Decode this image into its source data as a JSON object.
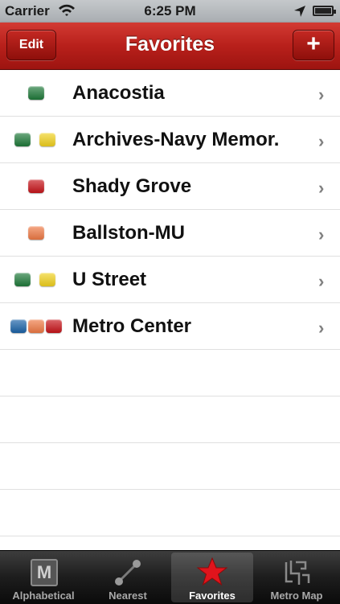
{
  "status_bar": {
    "carrier": "Carrier",
    "time": "6:25 PM",
    "wifi_icon": "wifi-icon",
    "location_icon": "location-arrow-icon",
    "battery_icon": "battery-icon"
  },
  "nav": {
    "title": "Favorites",
    "edit_label": "Edit",
    "add_label": "+"
  },
  "line_colors": {
    "green": "#1f7a3a",
    "yellow": "#f2d21e",
    "red": "#c8141a",
    "orange": "#f07a45",
    "blue": "#1b63a8"
  },
  "stations": [
    {
      "name": "Anacostia",
      "lines": [
        "green"
      ]
    },
    {
      "name": "Archives-Navy Memor.",
      "lines": [
        "green",
        "yellow"
      ]
    },
    {
      "name": "Shady Grove",
      "lines": [
        "red"
      ]
    },
    {
      "name": "Ballston-MU",
      "lines": [
        "orange"
      ]
    },
    {
      "name": "U Street",
      "lines": [
        "green",
        "yellow"
      ]
    },
    {
      "name": "Metro Center",
      "lines": [
        "blue",
        "orange",
        "red"
      ]
    }
  ],
  "tabs": [
    {
      "label": "Alphabetical",
      "icon": "m-icon",
      "selected": false
    },
    {
      "label": "Nearest",
      "icon": "nearest-icon",
      "selected": false
    },
    {
      "label": "Favorites",
      "icon": "star-icon",
      "selected": true
    },
    {
      "label": "Metro Map",
      "icon": "metro-map-icon",
      "selected": false
    }
  ]
}
